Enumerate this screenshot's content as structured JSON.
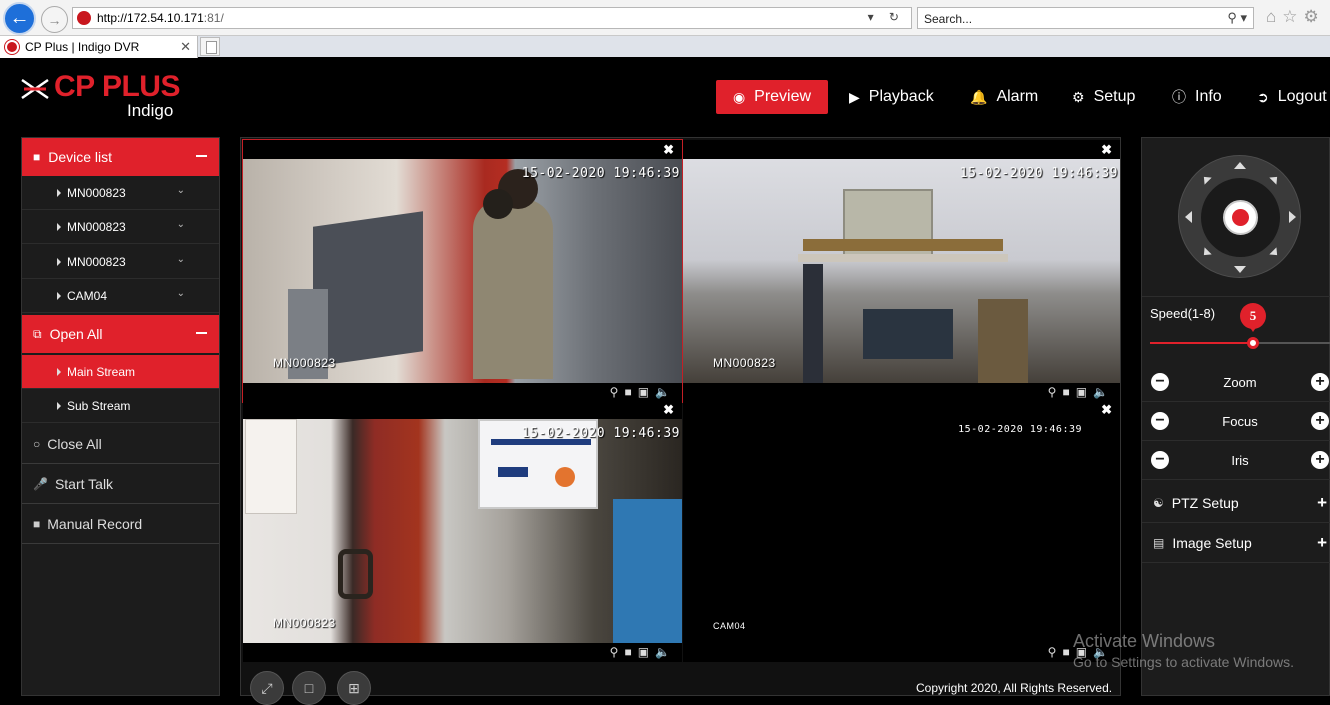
{
  "browser": {
    "url_host": "http://172.54.10.171",
    "url_rest": ":81/",
    "search_placeholder": "Search...",
    "tab_title": "CP Plus | Indigo DVR"
  },
  "brand": {
    "name": "CP PLUS",
    "product": "Indigo",
    "color": "#e0212b"
  },
  "topnav": [
    {
      "label": "Preview",
      "icon": "eye-icon",
      "active": true
    },
    {
      "label": "Playback",
      "icon": "play-circle-icon"
    },
    {
      "label": "Alarm",
      "icon": "bell-icon"
    },
    {
      "label": "Setup",
      "icon": "gear-icon"
    },
    {
      "label": "Info",
      "icon": "info-icon"
    },
    {
      "label": "Logout",
      "icon": "logout-icon"
    }
  ],
  "sidebar": {
    "device_list_label": "Device list",
    "devices": [
      "MN000823",
      "MN000823",
      "MN000823",
      "CAM04"
    ],
    "open_all_label": "Open All",
    "streams": [
      {
        "label": "Main Stream",
        "active": true
      },
      {
        "label": "Sub Stream",
        "active": false
      }
    ],
    "actions": [
      {
        "label": "Close All",
        "icon": "circle-icon"
      },
      {
        "label": "Start Talk",
        "icon": "microphone-icon"
      },
      {
        "label": "Manual Record",
        "icon": "video-camera-icon"
      }
    ]
  },
  "cameras": [
    {
      "timestamp": "15-02-2020 19:46:39",
      "name": "MN000823"
    },
    {
      "timestamp": "15-02-2020 19:46:39",
      "name": "MN000823"
    },
    {
      "timestamp": "15-02-2020 19:46:39",
      "name": "MN000823"
    },
    {
      "timestamp": "15-02-2020 19:46:39",
      "name": "CAM04"
    }
  ],
  "footer": {
    "copyright": "Copyright 2020, All Rights Reserved."
  },
  "ptz": {
    "speed_label": "Speed(1-8)",
    "speed_value": "5",
    "speed_min": 1,
    "speed_max": 8,
    "controls": [
      "Zoom",
      "Focus",
      "Iris"
    ],
    "sections": [
      {
        "label": "PTZ Setup",
        "icon": "gamepad-icon"
      },
      {
        "label": "Image Setup",
        "icon": "image-icon"
      }
    ]
  },
  "watermark": {
    "line1": "Activate Windows",
    "line2": "Go to Settings to activate Windows."
  }
}
